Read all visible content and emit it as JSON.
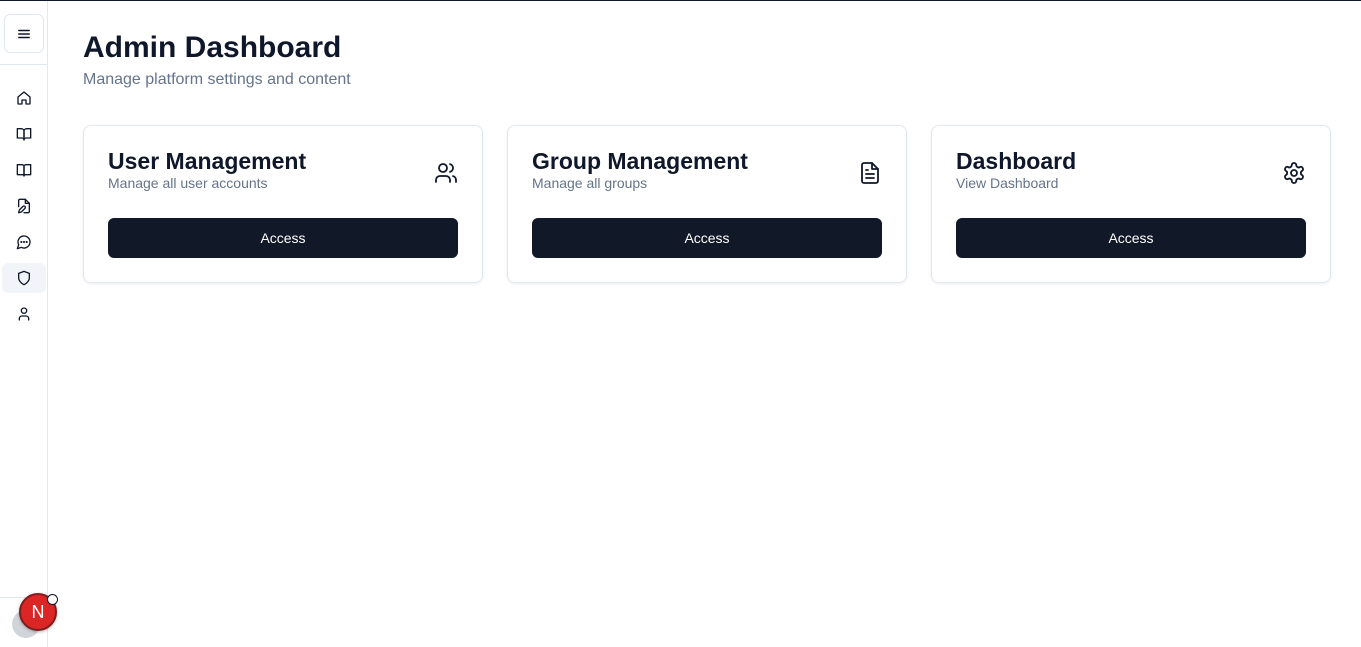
{
  "sidebar": {
    "menu_icon": "menu-icon",
    "items": [
      {
        "icon": "home-icon",
        "active": false
      },
      {
        "icon": "book-open-icon",
        "active": false
      },
      {
        "icon": "book-icon",
        "active": false
      },
      {
        "icon": "file-edit-icon",
        "active": false
      },
      {
        "icon": "message-circle-icon",
        "active": false
      },
      {
        "icon": "shield-icon",
        "active": true
      },
      {
        "icon": "user-icon",
        "active": false
      }
    ],
    "avatar_initial": "N",
    "avatar_color": "#dc2626"
  },
  "header": {
    "title": "Admin Dashboard",
    "subtitle": "Manage platform settings and content"
  },
  "cards": [
    {
      "title": "User Management",
      "description": "Manage all user accounts",
      "icon": "users-icon",
      "button_label": "Access"
    },
    {
      "title": "Group Management",
      "description": "Manage all groups",
      "icon": "file-text-icon",
      "button_label": "Access"
    },
    {
      "title": "Dashboard",
      "description": "View Dashboard",
      "icon": "settings-icon",
      "button_label": "Access"
    }
  ],
  "colors": {
    "primary_button": "#111827",
    "muted_text": "#64748b",
    "border": "#e2e8f0"
  }
}
